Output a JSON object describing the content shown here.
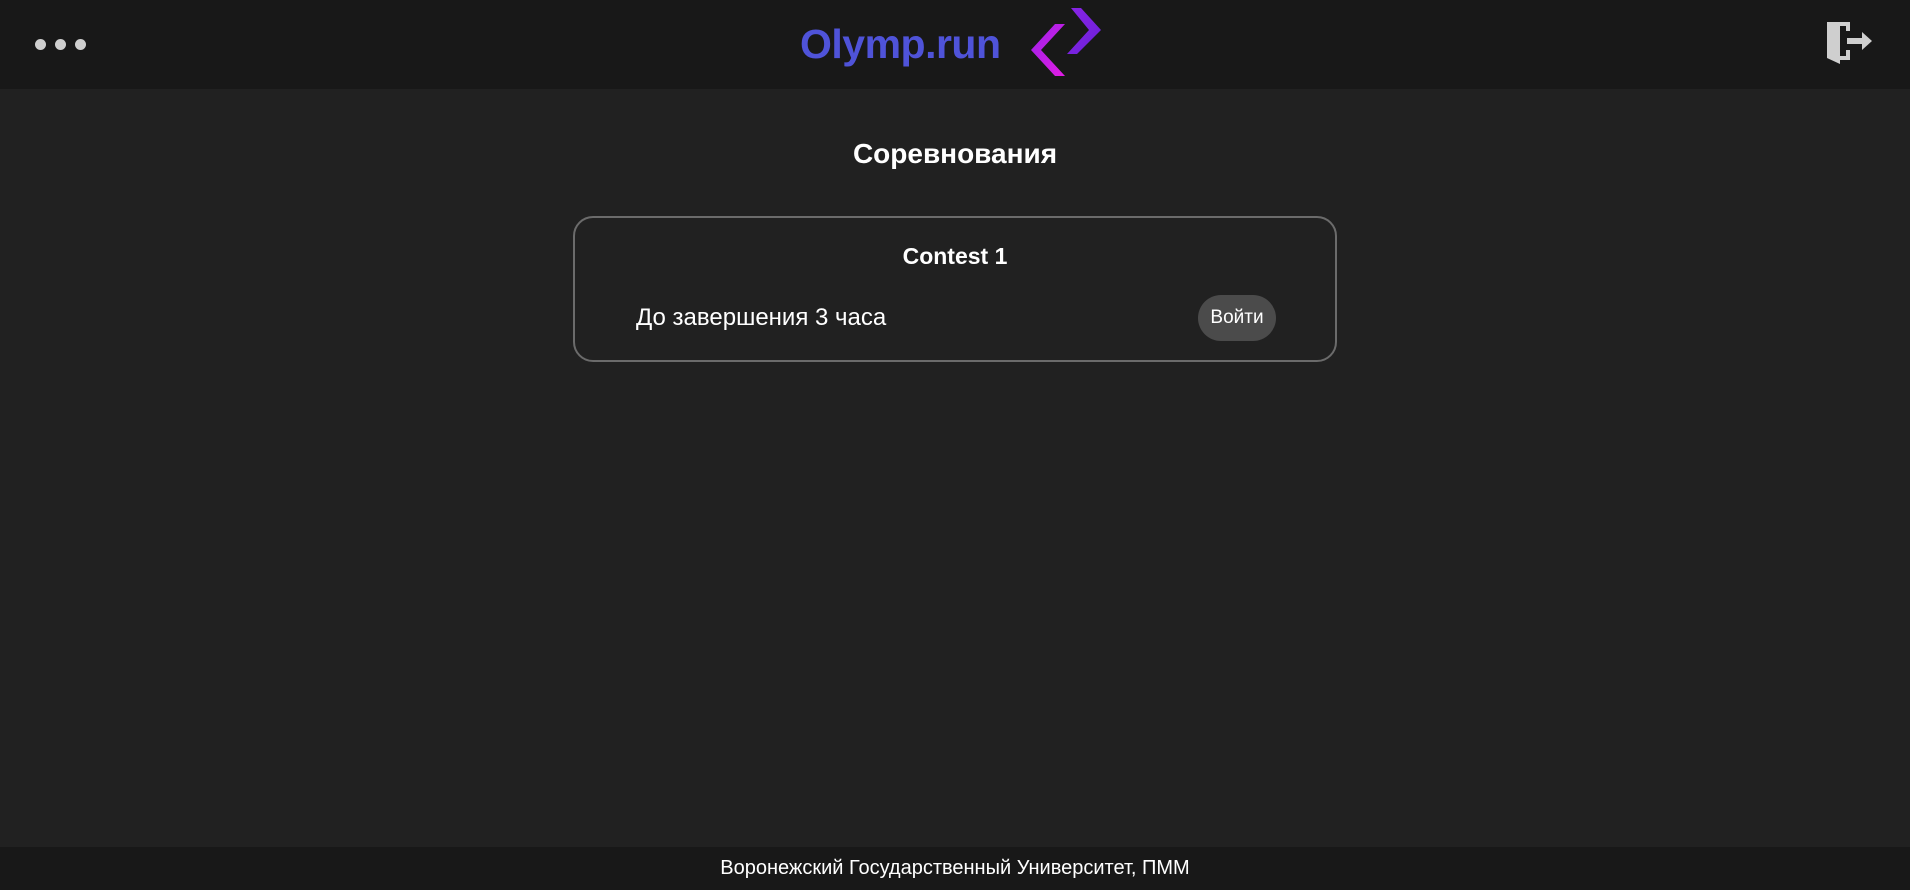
{
  "header": {
    "menu_icon": "more-horizontal-icon",
    "brand_name": "Olymp.run",
    "logo_icon": "chevrons-code-icon",
    "logout_icon": "logout-door-icon",
    "colors": {
      "brand": "#4f53d9",
      "logo_left": "#d11ee6",
      "logo_right": "#7a22e0"
    }
  },
  "main": {
    "title": "Соревнования",
    "contests": [
      {
        "title": "Contest 1",
        "status": "До завершения 3 часа",
        "enter_label": "Войти"
      }
    ]
  },
  "footer": {
    "text": "Воронежский Государственный Университет, ПММ"
  }
}
